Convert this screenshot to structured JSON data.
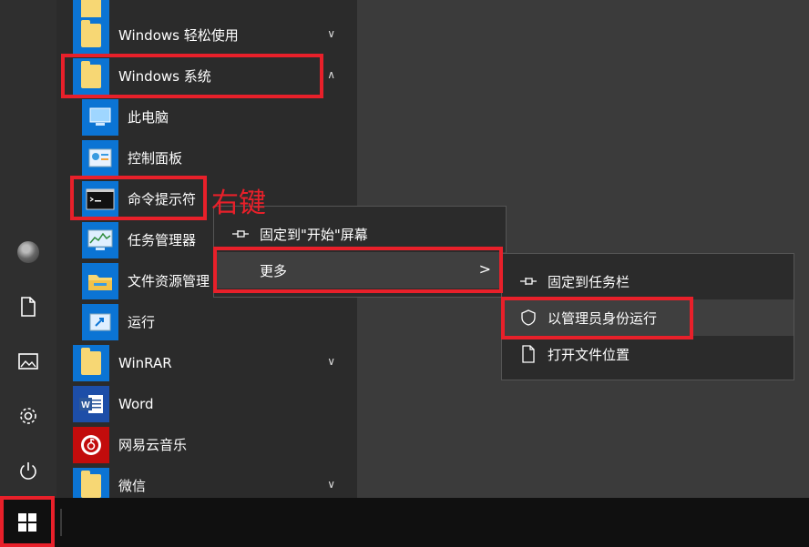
{
  "annotation": {
    "text": "右键",
    "color": "#e8202a"
  },
  "rail": {
    "icons": [
      "avatar",
      "document-icon",
      "pictures-icon",
      "gear-icon",
      "power-icon"
    ]
  },
  "list": {
    "items": [
      {
        "label": "Windows 轻松使用",
        "type": "folder",
        "chevron": "∨"
      },
      {
        "label": "Windows 系统",
        "type": "folder",
        "chevron": "∧"
      },
      {
        "label": "此电脑",
        "type": "app",
        "icon": "computer-icon"
      },
      {
        "label": "控制面板",
        "type": "app",
        "icon": "control-panel-icon"
      },
      {
        "label": "命令提示符",
        "type": "app",
        "icon": "cmd-icon"
      },
      {
        "label": "任务管理器",
        "type": "app",
        "icon": "task-manager-icon"
      },
      {
        "label": "文件资源管理",
        "type": "app",
        "icon": "file-explorer-icon"
      },
      {
        "label": "运行",
        "type": "app",
        "icon": "run-icon"
      },
      {
        "label": "WinRAR",
        "type": "folder",
        "chevron": "∨"
      },
      {
        "label": "Word",
        "type": "app",
        "icon": "word-icon"
      },
      {
        "label": "网易云音乐",
        "type": "app",
        "icon": "netease-music-icon"
      },
      {
        "label": "微信",
        "type": "folder",
        "chevron": "∨"
      }
    ]
  },
  "context_menu": {
    "items": [
      {
        "label": "固定到\"开始\"屏幕",
        "icon": "pin-icon"
      },
      {
        "label": "更多",
        "icon": "",
        "submenu_arrow": ">"
      }
    ]
  },
  "submenu": {
    "items": [
      {
        "label": "固定到任务栏",
        "icon": "pin-icon"
      },
      {
        "label": "以管理员身份运行",
        "icon": "shield-icon"
      },
      {
        "label": "打开文件位置",
        "icon": "document-icon"
      }
    ]
  },
  "colors": {
    "highlight": "#e8202a",
    "tile": "#0b74d4",
    "menu_bg": "#2b2b2b"
  }
}
